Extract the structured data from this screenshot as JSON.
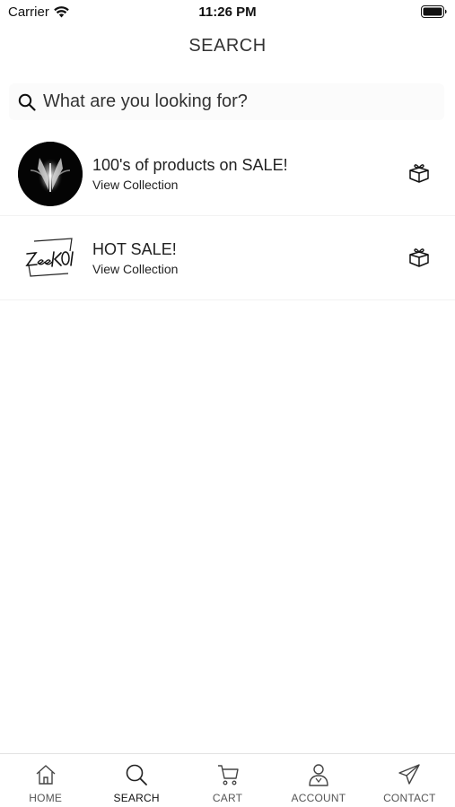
{
  "status_bar": {
    "carrier": "Carrier",
    "time": "11:26 PM"
  },
  "header": {
    "title": "SEARCH"
  },
  "search": {
    "placeholder": "What are you looking for?"
  },
  "collections": [
    {
      "title": "100's of products on SALE!",
      "subtitle": "View Collection"
    },
    {
      "title": "HOT SALE!",
      "subtitle": "View Collection"
    }
  ],
  "tabs": [
    {
      "label": "HOME",
      "icon": "home-icon",
      "active": false
    },
    {
      "label": "SEARCH",
      "icon": "search-icon",
      "active": true
    },
    {
      "label": "CART",
      "icon": "cart-icon",
      "active": false
    },
    {
      "label": "ACCOUNT",
      "icon": "account-icon",
      "active": false
    },
    {
      "label": "CONTACT",
      "icon": "paper-plane-icon",
      "active": false
    }
  ],
  "colors": {
    "background": "#ffffff",
    "text": "#222222",
    "divider": "#e2e2e2"
  }
}
